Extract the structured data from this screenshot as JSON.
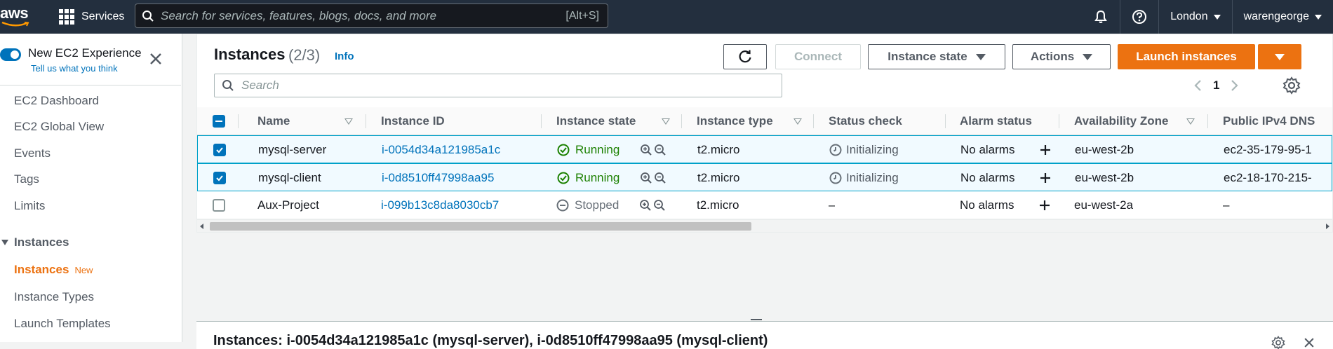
{
  "topbar": {
    "logo_text": "aws",
    "services_label": "Services",
    "search_placeholder": "Search for services, features, blogs, docs, and more",
    "search_shortcut": "[Alt+S]",
    "region": "London",
    "user": "warengeorge"
  },
  "sidebar": {
    "new_experience_title": "New EC2 Experience",
    "new_experience_sub": "Tell us what you think",
    "items": [
      {
        "label": "EC2 Dashboard"
      },
      {
        "label": "EC2 Global View"
      },
      {
        "label": "Events"
      },
      {
        "label": "Tags"
      },
      {
        "label": "Limits"
      }
    ],
    "section_label": "Instances",
    "section_items": [
      {
        "label": "Instances",
        "badge": "New",
        "active": true
      },
      {
        "label": "Instance Types"
      },
      {
        "label": "Launch Templates"
      }
    ]
  },
  "panel": {
    "title": "Instances",
    "count": "(2/3)",
    "info": "Info",
    "connect": "Connect",
    "instance_state": "Instance state",
    "actions": "Actions",
    "launch": "Launch instances",
    "filter_placeholder": "Search",
    "page": "1"
  },
  "table": {
    "headers": [
      "Name",
      "Instance ID",
      "Instance state",
      "Instance type",
      "Status check",
      "Alarm status",
      "Availability Zone",
      "Public IPv4 DNS"
    ],
    "rows": [
      {
        "name": "mysql-server",
        "id": "i-0054d34a121985a1c",
        "state": "Running",
        "type": "t2.micro",
        "status": "Initializing",
        "alarm": "No alarms",
        "az": "eu-west-2b",
        "dns": "ec2-35-179-95-1",
        "selected": true
      },
      {
        "name": "mysql-client",
        "id": "i-0d8510ff47998aa95",
        "state": "Running",
        "type": "t2.micro",
        "status": "Initializing",
        "alarm": "No alarms",
        "az": "eu-west-2b",
        "dns": "ec2-18-170-215-",
        "selected": true
      },
      {
        "name": "Aux-Project",
        "id": "i-099b13c8da8030cb7",
        "state": "Stopped",
        "type": "t2.micro",
        "status": "–",
        "alarm": "No alarms",
        "az": "eu-west-2a",
        "dns": "–",
        "selected": false
      }
    ]
  },
  "bottom": {
    "title": "Instances: i-0054d34a121985a1c (mysql-server), i-0d8510ff47998aa95 (mysql-client)"
  },
  "colors": {
    "topbar": "#232f3e",
    "accent_orange": "#ec7211",
    "link_blue": "#0073bb",
    "running_green": "#1d8102"
  }
}
